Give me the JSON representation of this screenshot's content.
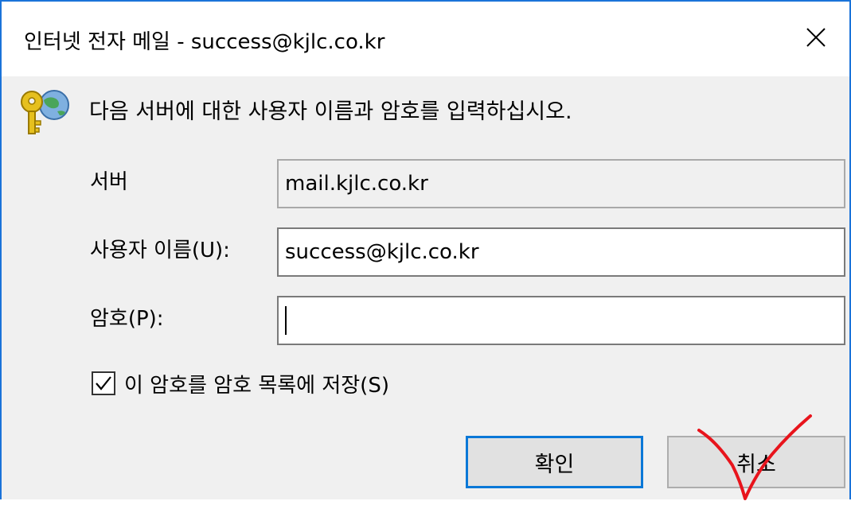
{
  "window": {
    "title": "인터넷 전자 메일 - success@kjlc.co.kr"
  },
  "prompt": {
    "text": "다음 서버에 대한 사용자 이름과 암호를 입력하십시오."
  },
  "form": {
    "server_label": "서버",
    "server_value": "mail.kjlc.co.kr",
    "username_label": "사용자 이름(U):",
    "username_value": "success@kjlc.co.kr",
    "password_label": "암호(P):",
    "password_value": ""
  },
  "save_checkbox": {
    "label": "이 암호를 암호 목록에 저장(S)",
    "checked": true
  },
  "buttons": {
    "ok": "확인",
    "cancel": "취소"
  },
  "icons": {
    "prompt": "key-globe-icon",
    "close": "close-icon",
    "checkmark": "checkmark-icon",
    "annotation": "red-checkmark-annotation"
  },
  "colors": {
    "window_border": "#1a73d9",
    "primary_button_border": "#0a78d7",
    "annotation": "#e8141c"
  }
}
